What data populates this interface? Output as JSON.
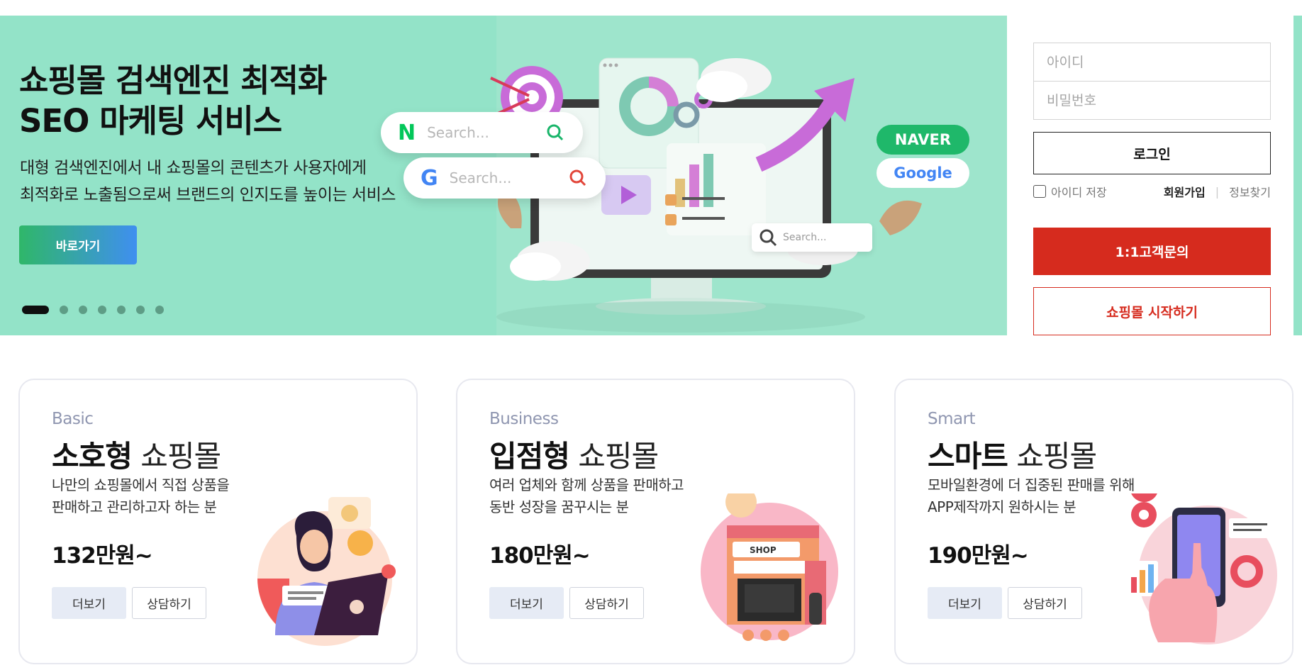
{
  "hero": {
    "title_lines": [
      "쇼핑몰 검색엔진 최적화",
      "SEO 마케팅 서비스"
    ],
    "desc_lines": [
      "대형 검색엔진에서 내 쇼핑몰의 콘텐츠가 사용자에게",
      "최적화로 노출됨으로써 브랜드의 인지도를 높이는 서비스"
    ],
    "cta_label": "바로가기",
    "slides_total": 7,
    "slide_active": 1,
    "illustration": {
      "search1_logo": "N",
      "search1_placeholder": "Search...",
      "search2_logo": "G",
      "search2_placeholder": "Search...",
      "badge_naver": "NAVER",
      "badge_google": "Google",
      "mini_search_placeholder": "Search..."
    },
    "colors": {
      "bg": "#93e3c8",
      "naver_green": "#03c75a",
      "cta_from": "#2fb769",
      "cta_to": "#3f8ff0"
    }
  },
  "login": {
    "id_placeholder": "아이디",
    "pw_placeholder": "비밀번호",
    "login_label": "로그인",
    "remember_label": "아이디 저장",
    "remember_checked": false,
    "join_label": "회원가입",
    "separator": "|",
    "find_label": "정보찾기",
    "inquiry_label": "1:1고객문의",
    "start_label": "쇼핑몰 시작하기",
    "colors": {
      "accent": "#d62b1e"
    }
  },
  "plans": [
    {
      "eng": "Basic",
      "title_bold": "소호형",
      "title_rest": "쇼핑몰",
      "desc_lines": [
        "나만의 쇼핑몰에서 직접 상품을",
        "판매하고 관리하고자 하는 분"
      ],
      "price": "132만원~",
      "more_label": "더보기",
      "consult_label": "상담하기"
    },
    {
      "eng": "Business",
      "title_bold": "입점형",
      "title_rest": "쇼핑몰",
      "desc_lines": [
        "여러 업체와 함께 상품을 판매하고",
        "동반 성장을 꿈꾸시는 분"
      ],
      "price": "180만원~",
      "more_label": "더보기",
      "consult_label": "상담하기",
      "shop_sign": "SHOP"
    },
    {
      "eng": "Smart",
      "title_bold": "스마트",
      "title_rest": "쇼핑몰",
      "desc_lines": [
        "모바일환경에 더 집중된 판매를 위해",
        "APP제작까지 원하시는 분"
      ],
      "price": "190만원~",
      "more_label": "더보기",
      "consult_label": "상담하기"
    }
  ]
}
